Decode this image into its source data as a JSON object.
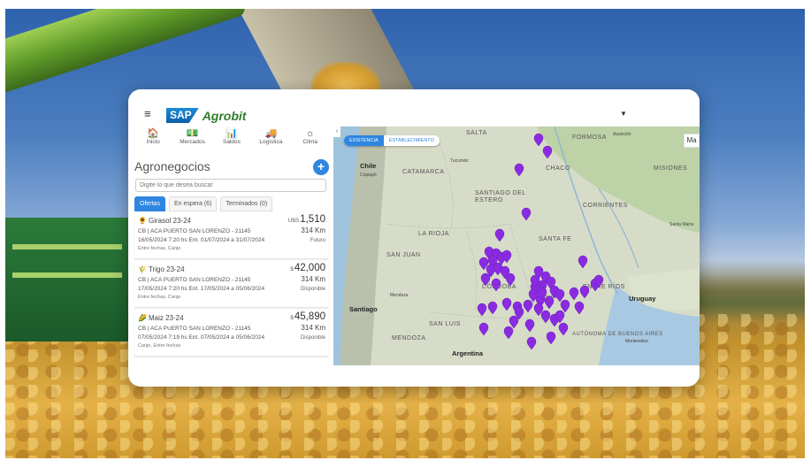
{
  "app": {
    "menu_icon": "menu-icon",
    "logo_sap": "SAP",
    "logo_name": "Agrobit",
    "user_caret": "▼"
  },
  "nav": [
    {
      "label": "Inicio",
      "icon": "home-icon",
      "glyph": "🏠"
    },
    {
      "label": "Mercados",
      "icon": "cash-icon",
      "glyph": "💵"
    },
    {
      "label": "Saldos",
      "icon": "bar-chart-icon",
      "glyph": "📊"
    },
    {
      "label": "Logística",
      "icon": "truck-icon",
      "glyph": "🚚"
    },
    {
      "label": "Clima",
      "icon": "sun-icon",
      "glyph": "☼"
    }
  ],
  "section": {
    "title": "Agronegocios",
    "add": "+",
    "search_placeholder": "Digite lo que desea buscar"
  },
  "tabs": [
    {
      "label": "Ofertas",
      "active": true
    },
    {
      "label": "En espera (6)",
      "active": false
    },
    {
      "label": "Terminados (0)",
      "active": false
    }
  ],
  "offers": [
    {
      "emoji": "🌻",
      "name": "Girasol 23-24",
      "currency": "U$S",
      "price": "1,510",
      "line1": "CB | ACA PUERTO SAN LORENZO - 21145",
      "km": "314 Km",
      "line2": "16/05/2024 7:20 hs Ent. 01/07/2024 a 31/07/2024",
      "status": "Futuro",
      "line3": "Entre fechas, Canje"
    },
    {
      "emoji": "🌾",
      "name": "Trigo 23-24",
      "currency": "$",
      "price": "42,000",
      "line1": "CB | ACA PUERTO SAN LORENZO - 21145",
      "km": "314 Km",
      "line2": "17/05/2024 7:20 hs Ent. 17/05/2024 a 05/06/2024",
      "status": "Disponible",
      "line3": "Entre fechas, Canje"
    },
    {
      "emoji": "🌽",
      "name": "Maiz 23-24",
      "currency": "$",
      "price": "45,890",
      "line1": "CB | ACA PUERTO SAN LORENZO - 21145",
      "km": "314 Km",
      "line2": "07/05/2024 7:19 hs Ent. 07/05/2024 a 05/06/2024",
      "status": "Disponible",
      "line3": "Canje, Entre fechas"
    }
  ],
  "map": {
    "tabs": [
      {
        "label": "EXISTENCIA",
        "active": true
      },
      {
        "label": "ESTABLECIMIENTO",
        "active": false
      }
    ],
    "collapse": "‹",
    "side_button": "Ma",
    "labels": [
      {
        "t": "SALTA",
        "cls": ""
      },
      {
        "t": "FORMOSA",
        "cls": ""
      },
      {
        "t": "Asunción",
        "cls": "city"
      },
      {
        "t": "Chile",
        "cls": "big"
      },
      {
        "t": "CATAMARCA",
        "cls": ""
      },
      {
        "t": "CHACO",
        "cls": ""
      },
      {
        "t": "MISIONES",
        "cls": ""
      },
      {
        "t": "SANTIAGO DEL ESTERO",
        "cls": ""
      },
      {
        "t": "CORRIENTES",
        "cls": ""
      },
      {
        "t": "LA RIOJA",
        "cls": ""
      },
      {
        "t": "SANTA FE",
        "cls": ""
      },
      {
        "t": "SAN JUAN",
        "cls": ""
      },
      {
        "t": "CÓRDOBA",
        "cls": ""
      },
      {
        "t": "Uruguay",
        "cls": "big"
      },
      {
        "t": "Santiago",
        "cls": "big"
      },
      {
        "t": "SAN LUIS",
        "cls": ""
      },
      {
        "t": "MENDOZA",
        "cls": ""
      },
      {
        "t": "Montevideo",
        "cls": "city"
      },
      {
        "t": "Argentina",
        "cls": "big"
      },
      {
        "t": "ENTRE RÍOS",
        "cls": ""
      },
      {
        "t": "Rosario",
        "cls": "city"
      },
      {
        "t": "Santa María",
        "cls": "city"
      },
      {
        "t": "Mendoza",
        "cls": "city"
      },
      {
        "t": "Copiapó",
        "cls": "city"
      },
      {
        "t": "Tucumán",
        "cls": "city"
      },
      {
        "t": "AUTÓNOMA DE BUENOS AIRES",
        "cls": ""
      }
    ]
  }
}
